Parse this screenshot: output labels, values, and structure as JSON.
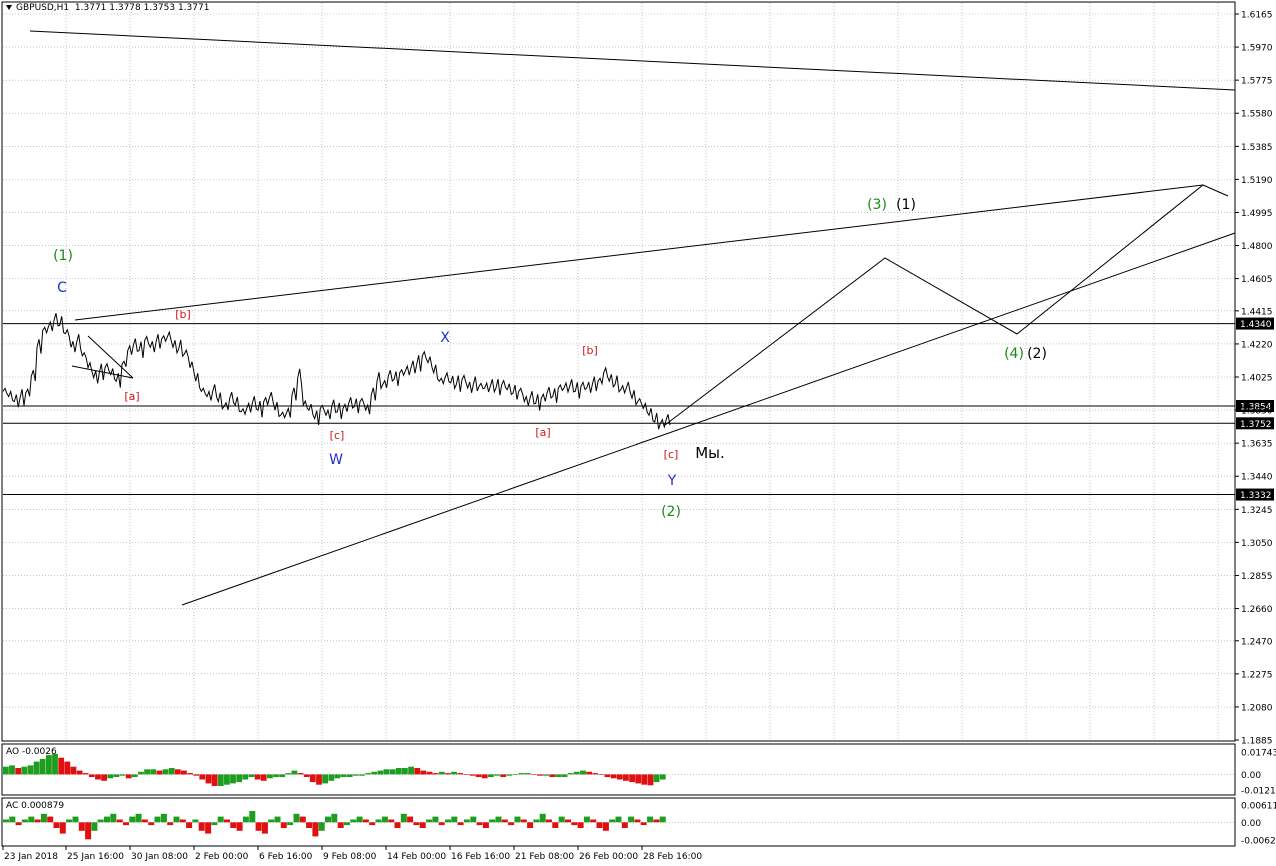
{
  "header": {
    "symbol": "GBPUSD,H1",
    "ohlc": "1.3771 1.3778 1.3753 1.3771"
  },
  "chart_data": [
    {
      "type": "line",
      "panel": "price",
      "title": "GBPUSD,H1",
      "ylim": [
        1.1885,
        1.6165
      ],
      "y_ticks": [
        "1.6165",
        "1.5970",
        "1.5775",
        "1.5580",
        "1.5385",
        "1.5190",
        "1.4995",
        "1.4800",
        "1.4605",
        "1.4415",
        "1.4220",
        "1.4025",
        "1.3830",
        "1.3635",
        "1.3440",
        "1.3245",
        "1.3050",
        "1.2855",
        "1.2660",
        "1.2470",
        "1.2275",
        "1.2080",
        "1.1885"
      ],
      "x_ticks": [
        "23 Jan 2018",
        "25 Jan 16:00",
        "30 Jan 08:00",
        "2 Feb 00:00",
        "6 Feb 16:00",
        "9 Feb 08:00",
        "14 Feb 00:00",
        "16 Feb 16:00",
        "21 Feb 08:00",
        "26 Feb 00:00",
        "28 Feb 16:00"
      ],
      "price_path": [
        1.394,
        1.391,
        1.388,
        1.39,
        1.393,
        1.403,
        1.42,
        1.43,
        1.432,
        1.436,
        1.433,
        1.428,
        1.42,
        1.423,
        1.415,
        1.408,
        1.402,
        1.405,
        1.408,
        1.404,
        1.4,
        1.41,
        1.418,
        1.421,
        1.418,
        1.424,
        1.42,
        1.423,
        1.425,
        1.426,
        1.42,
        1.419,
        1.416,
        1.408,
        1.4,
        1.394,
        1.391,
        1.394,
        1.388,
        1.385,
        1.39,
        1.386,
        1.382,
        1.384,
        1.387,
        1.383,
        1.388,
        1.39,
        1.383,
        1.38,
        1.381,
        1.392,
        1.402,
        1.386,
        1.383,
        1.378,
        1.384,
        1.38,
        1.385,
        1.382,
        1.384,
        1.387,
        1.385,
        1.388,
        1.383,
        1.392,
        1.4,
        1.398,
        1.403,
        1.401,
        1.405,
        1.406,
        1.408,
        1.41,
        1.415,
        1.411,
        1.405,
        1.4,
        1.402,
        1.399,
        1.398,
        1.401,
        1.396,
        1.398,
        1.397,
        1.396,
        1.397,
        1.396,
        1.398,
        1.395,
        1.393,
        1.394,
        1.388,
        1.39,
        1.387,
        1.39,
        1.393,
        1.391,
        1.396,
        1.396,
        1.397,
        1.394,
        1.397,
        1.396,
        1.398,
        1.4,
        1.405,
        1.4,
        1.398,
        1.395,
        1.396,
        1.39,
        1.388,
        1.384,
        1.38,
        1.376,
        1.375,
        1.377
      ],
      "price_path_range": [
        "23 Jan 2018",
        "28 Feb 16:00"
      ],
      "horizontal_levels": [
        {
          "label": "1.4340",
          "value": 1.434
        },
        {
          "label": "1.3854",
          "value": 1.3854
        },
        {
          "label": "1.3752",
          "value": 1.3752
        },
        {
          "label": "1.3332",
          "value": 1.3332
        }
      ],
      "current_price_label": "1.3771",
      "wave_labels": [
        {
          "text": "(1)",
          "color": "#1a8c1a",
          "price": 1.475
        },
        {
          "text": "C",
          "color": "#1f32c8",
          "price": 1.452
        },
        {
          "text": "[b]",
          "color": "#d01818",
          "price": 1.437
        },
        {
          "text": "[a]",
          "color": "#d01818",
          "price": 1.392
        },
        {
          "text": "[c]",
          "color": "#d01818",
          "price": 1.365
        },
        {
          "text": "W",
          "color": "#1f32c8",
          "price": 1.342
        },
        {
          "text": "X",
          "color": "#1f32c8",
          "price": 1.425
        },
        {
          "text": "[b]",
          "color": "#d01818",
          "price": 1.418
        },
        {
          "text": "[a]",
          "color": "#d01818",
          "price": 1.366
        },
        {
          "text": "[c]",
          "color": "#d01818",
          "price": 1.3455
        },
        {
          "text": "Y",
          "color": "#1f32c8",
          "price": 1.326
        },
        {
          "text": "(2)",
          "color": "#1a8c1a",
          "price": 1.308
        },
        {
          "text": "Мы.",
          "color": "#000000",
          "price": 1.346
        },
        {
          "text": "(3)",
          "color": "#1a8c1a",
          "price": 1.502
        },
        {
          "text": "(1)",
          "color": "#000000",
          "price": 1.502
        },
        {
          "text": "(4)",
          "color": "#1a8c1a",
          "price": 1.416
        },
        {
          "text": "(2)",
          "color": "#000000",
          "price": 1.416
        }
      ]
    },
    {
      "type": "bar",
      "panel": "AO",
      "title": "AO -0.0026",
      "ylim": [
        -0.01212,
        0.01743
      ],
      "y_ticks": [
        "0.01743",
        "0.00",
        "-0.01212"
      ],
      "positive_color": "#1e9d1e",
      "negative_color": "#e01010",
      "values": [
        0.006,
        0.007,
        0.005,
        0.006,
        0.007,
        0.01,
        0.012,
        0.015,
        0.016,
        0.013,
        0.01,
        0.006,
        0.003,
        0.001,
        -0.002,
        -0.004,
        -0.005,
        -0.003,
        -0.002,
        -0.001,
        -0.003,
        -0.002,
        0.002,
        0.004,
        0.004,
        0.003,
        0.004,
        0.005,
        0.004,
        0.003,
        0.001,
        -0.001,
        -0.004,
        -0.007,
        -0.009,
        -0.009,
        -0.008,
        -0.007,
        -0.006,
        -0.004,
        -0.002,
        -0.004,
        -0.005,
        -0.003,
        -0.002,
        -0.002,
        0.001,
        0.003,
        0.001,
        -0.002,
        -0.006,
        -0.008,
        -0.007,
        -0.005,
        -0.003,
        -0.002,
        -0.002,
        -0.001,
        -0.001,
        0.001,
        0.002,
        0.003,
        0.004,
        0.004,
        0.005,
        0.005,
        0.006,
        0.005,
        0.003,
        0.002,
        0.001,
        0.002,
        0.001,
        0.002,
        0.001,
        0.0,
        -0.001,
        -0.002,
        -0.003,
        -0.002,
        -0.001,
        -0.002,
        -0.001,
        0.0,
        0.001,
        0.001,
        0.0,
        -0.001,
        -0.001,
        -0.002,
        -0.002,
        -0.002,
        0.001,
        0.002,
        0.003,
        0.002,
        0.001,
        0.0,
        -0.002,
        -0.003,
        -0.004,
        -0.005,
        -0.006,
        -0.007,
        -0.008,
        -0.0085,
        -0.006,
        -0.004
      ]
    },
    {
      "type": "bar",
      "panel": "AC",
      "title": "AC 0.000879",
      "ylim": [
        -0.00627,
        0.006116
      ],
      "y_ticks": [
        "0.006116",
        "0.00",
        "-0.00627"
      ],
      "positive_color": "#1e9d1e",
      "negative_color": "#e01010",
      "values": [
        0.001,
        0.002,
        -0.001,
        0.001,
        0.002,
        0.001,
        0.003,
        0.002,
        -0.002,
        -0.004,
        0.001,
        0.002,
        -0.003,
        -0.006,
        -0.003,
        0.001,
        0.002,
        0.003,
        0.001,
        -0.001,
        0.002,
        0.003,
        0.001,
        -0.001,
        0.002,
        0.003,
        -0.001,
        0.002,
        0.001,
        -0.002,
        0.001,
        -0.003,
        -0.004,
        -0.001,
        0.002,
        0.001,
        -0.002,
        -0.003,
        0.002,
        0.004,
        -0.003,
        -0.004,
        0.001,
        0.002,
        -0.002,
        -0.001,
        0.003,
        0.002,
        -0.002,
        -0.005,
        -0.003,
        0.002,
        0.003,
        -0.002,
        -0.001,
        0.001,
        0.002,
        0.001,
        -0.001,
        0.001,
        0.002,
        0.001,
        -0.002,
        0.003,
        0.002,
        -0.001,
        -0.002,
        0.001,
        0.002,
        -0.001,
        0.001,
        0.002,
        -0.001,
        0.001,
        0.002,
        -0.001,
        -0.002,
        0.001,
        0.002,
        0.001,
        -0.001,
        0.002,
        0.001,
        -0.002,
        0.001,
        0.003,
        0.001,
        -0.002,
        0.002,
        0.001,
        -0.001,
        -0.002,
        0.002,
        0.001,
        -0.002,
        -0.003,
        0.001,
        0.002,
        -0.002,
        0.002,
        0.001,
        -0.001,
        0.002,
        0.001,
        0.002
      ]
    }
  ]
}
